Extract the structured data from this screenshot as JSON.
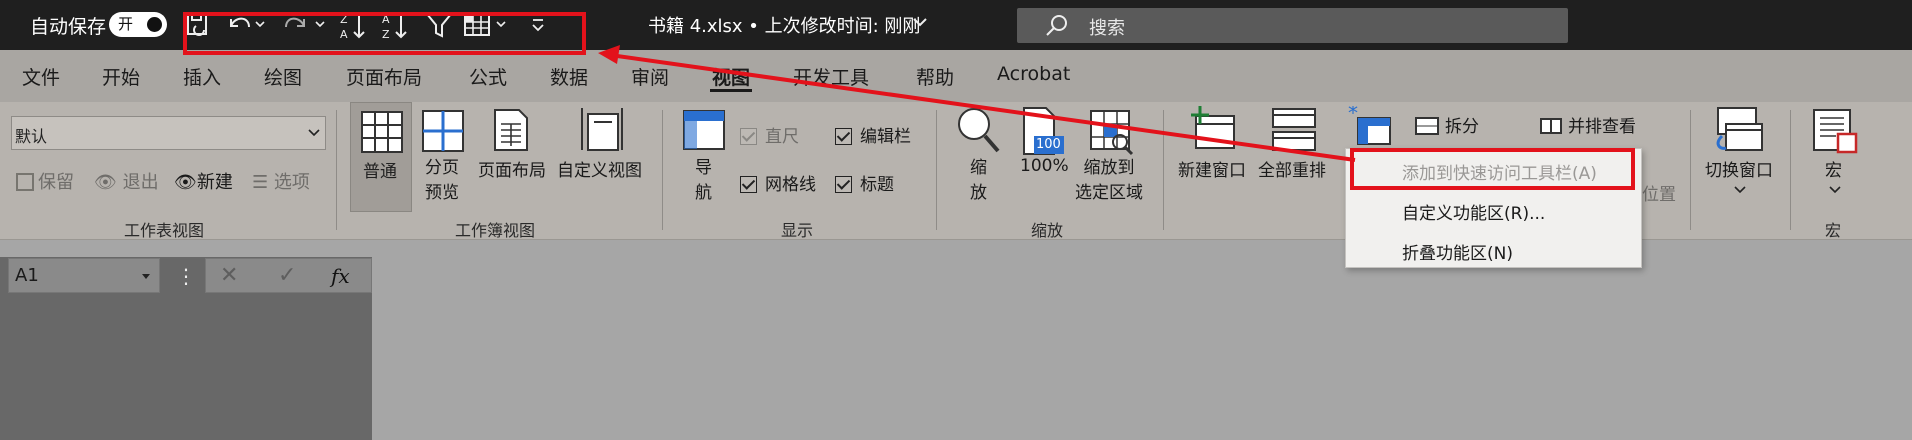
{
  "titlebar": {
    "autosave_label": "自动保存",
    "toggle_label": "开",
    "doc_title": "书籍 4.xlsx • 上次修改时间: 刚刚",
    "search_placeholder": "搜索"
  },
  "tabs": [
    "文件",
    "开始",
    "插入",
    "绘图",
    "页面布局",
    "公式",
    "数据",
    "审阅",
    "视图",
    "开发工具",
    "帮助",
    "Acrobat"
  ],
  "active_tab": "视图",
  "ribbon": {
    "sheet_view": {
      "default_value": "默认",
      "keep": "保留",
      "exit": "退出",
      "new": "新建",
      "options": "选项",
      "group_label": "工作表视图"
    },
    "workbook_view": {
      "normal": "普通",
      "page_break_1": "分页",
      "page_break_2": "预览",
      "page_layout": "页面布局",
      "custom_view": "自定义视图",
      "group_label": "工作簿视图"
    },
    "show": {
      "nav_1": "导",
      "nav_2": "航",
      "ruler": "直尺",
      "formula_bar": "编辑栏",
      "gridlines": "网格线",
      "headings": "标题",
      "group_label": "显示"
    },
    "zoom": {
      "zoom_1": "缩",
      "zoom_2": "放",
      "hundred": "100%",
      "zoom_sel_1": "缩放到",
      "zoom_sel_2": "选定区域",
      "group_label": "缩放",
      "badge": "100"
    },
    "window": {
      "new_window": "新建窗口",
      "arrange_all": "全部重排",
      "split": "拆分",
      "side_by_side": "并排查看",
      "reset_position": "位置",
      "switch_window": "切换窗口"
    },
    "macros": {
      "label": "宏",
      "group_label": "宏"
    }
  },
  "formula_bar": {
    "name_box": "A1",
    "fx": "fx"
  },
  "context_menu": {
    "items": [
      "添加到快速访问工具栏(A)",
      "自定义功能区(R)...",
      "折叠功能区(N)"
    ]
  },
  "colors": {
    "highlight": "#e3121b",
    "titlebar": "#1f1f1f",
    "ribbon": "#b7b3ae"
  }
}
